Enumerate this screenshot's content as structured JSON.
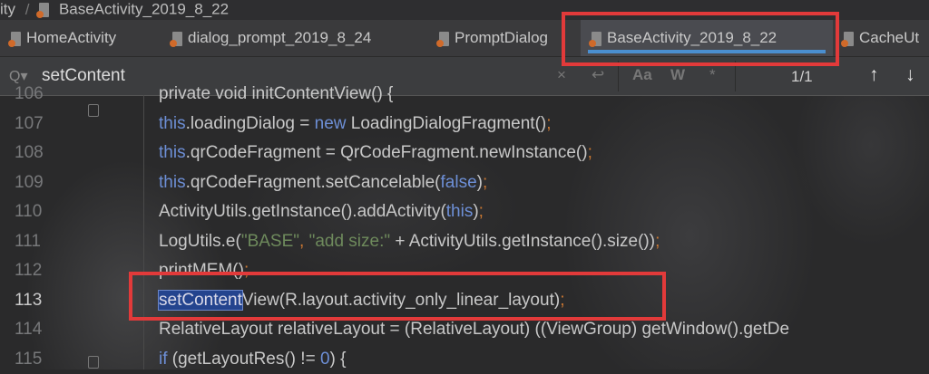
{
  "breadcrumb": {
    "parent": "ity",
    "separator": "/",
    "file": "BaseActivity_2019_8_22"
  },
  "tabs": [
    {
      "label": "HomeActivity",
      "active": false
    },
    {
      "label": "dialog_prompt_2019_8_24",
      "active": false
    },
    {
      "label": "PromptDialog",
      "active": false
    },
    {
      "label": "BaseActivity_2019_8_22",
      "active": true
    },
    {
      "label": "CacheUt",
      "active": false
    }
  ],
  "search": {
    "value": "setContent",
    "match_count": "1/1",
    "icons": {
      "search": "magnifier-icon",
      "clear": "×",
      "regex_newline": "↩",
      "match_case": "Aa",
      "words": "W",
      "regex": "*",
      "prev": "↑",
      "next": "↓"
    }
  },
  "colors": {
    "accent": "#4a8fd0",
    "highlight_box": "#e23a3a",
    "keyword": "#6d8fd6",
    "string": "#6e8a5c",
    "selection": "#24448e"
  },
  "code": {
    "lines": [
      {
        "number": "106",
        "tokens": [
          [
            "private void initContentView() {",
            "txt"
          ]
        ]
      },
      {
        "number": "107",
        "tokens": [
          [
            "this",
            "kw"
          ],
          [
            ".loadingDialog = ",
            "txt"
          ],
          [
            "new",
            "kw"
          ],
          [
            " LoadingDialogFragment()",
            "txt"
          ],
          [
            ";",
            "punc"
          ]
        ]
      },
      {
        "number": "108",
        "tokens": [
          [
            "this",
            "kw"
          ],
          [
            ".qrCodeFragment = QrCodeFragment.newInstance()",
            "txt"
          ],
          [
            ";",
            "punc"
          ]
        ]
      },
      {
        "number": "109",
        "tokens": [
          [
            "this",
            "kw"
          ],
          [
            ".qrCodeFragment.setCancelable(",
            "txt"
          ],
          [
            "false",
            "kw"
          ],
          [
            ")",
            "txt"
          ],
          [
            ";",
            "punc"
          ]
        ]
      },
      {
        "number": "110",
        "tokens": [
          [
            "ActivityUtils.getInstance().addActivity(",
            "txt"
          ],
          [
            "this",
            "kw"
          ],
          [
            ")",
            "txt"
          ],
          [
            ";",
            "punc"
          ]
        ]
      },
      {
        "number": "111",
        "tokens": [
          [
            "LogUtils.e(",
            "txt"
          ],
          [
            "\"BASE\"",
            "str"
          ],
          [
            ", ",
            "punc"
          ],
          [
            "\"add size:\"",
            "str"
          ],
          [
            " + ActivityUtils.getInstance().size())",
            "txt"
          ],
          [
            ";",
            "punc"
          ]
        ]
      },
      {
        "number": "112",
        "tokens": [
          [
            "printMEM()",
            "txt"
          ],
          [
            ";",
            "punc"
          ]
        ]
      },
      {
        "number": "113",
        "current": true,
        "tokens": [
          [
            "setContent",
            "hl"
          ],
          [
            "View(R.layout.activity_only_linear_layout)",
            "txt"
          ],
          [
            ";",
            "punc"
          ]
        ]
      },
      {
        "number": "114",
        "tokens": [
          [
            "RelativeLayout relativeLayout = (RelativeLayout) ((ViewGroup) getWindow().getDe",
            "txt"
          ]
        ]
      },
      {
        "number": "115",
        "tokens": [
          [
            "if",
            "kw"
          ],
          [
            " (getLayoutRes() != ",
            "txt"
          ],
          [
            "0",
            "kw"
          ],
          [
            ") {",
            "txt"
          ]
        ]
      }
    ]
  }
}
